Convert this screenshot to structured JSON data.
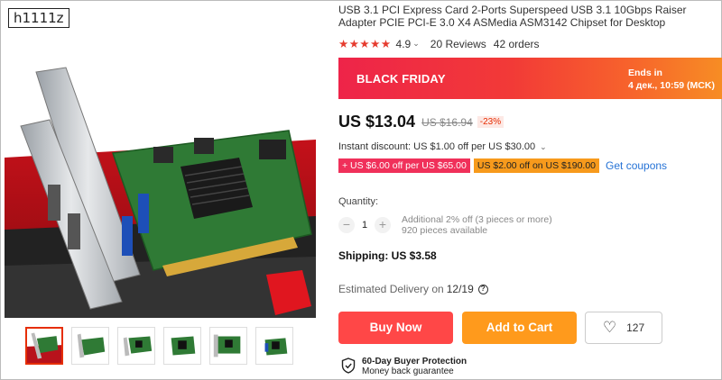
{
  "watermark": "h1111z",
  "product": {
    "title": "USB 3.1 PCI Express Card 2-Ports Superspeed USB 3.1 10Gbps Raiser Adapter PCIE PCI-E 3.0 X4 ASMedia ASM3142 Chipset for Desktop",
    "rating": "4.9",
    "reviews": "20 Reviews",
    "orders": "42 orders"
  },
  "banner": {
    "title": "BLACK FRIDAY",
    "ends_label": "Ends in",
    "ends_time": "4 дек., 10:59 (MCK)"
  },
  "price": {
    "current": "US $13.04",
    "original": "US $16.94",
    "discount": "-23%"
  },
  "instant_discount": "Instant discount: US $1.00 off per US $30.00",
  "coupons": {
    "red": "+ US $6.00 off per US $65.00",
    "orange": "US $2.00 off on US $190.00",
    "get_label": "Get coupons"
  },
  "quantity": {
    "label": "Quantity:",
    "minus": "−",
    "value": "1",
    "plus": "+",
    "note_line1": "Additional 2% off (3 pieces or more)",
    "note_line2": "920 pieces available"
  },
  "shipping": "Shipping: US $3.58",
  "delivery": {
    "label": "Estimated Delivery on",
    "date": "12/19",
    "help": "?"
  },
  "buttons": {
    "buy": "Buy Now",
    "cart": "Add to Cart",
    "wishlist_count": "127"
  },
  "protection": {
    "title": "60-Day Buyer Protection",
    "subtitle": "Money back guarantee"
  },
  "colors": {
    "accent_red": "#ff4747",
    "accent_orange": "#ff9a1c",
    "link_blue": "#2673d6"
  }
}
